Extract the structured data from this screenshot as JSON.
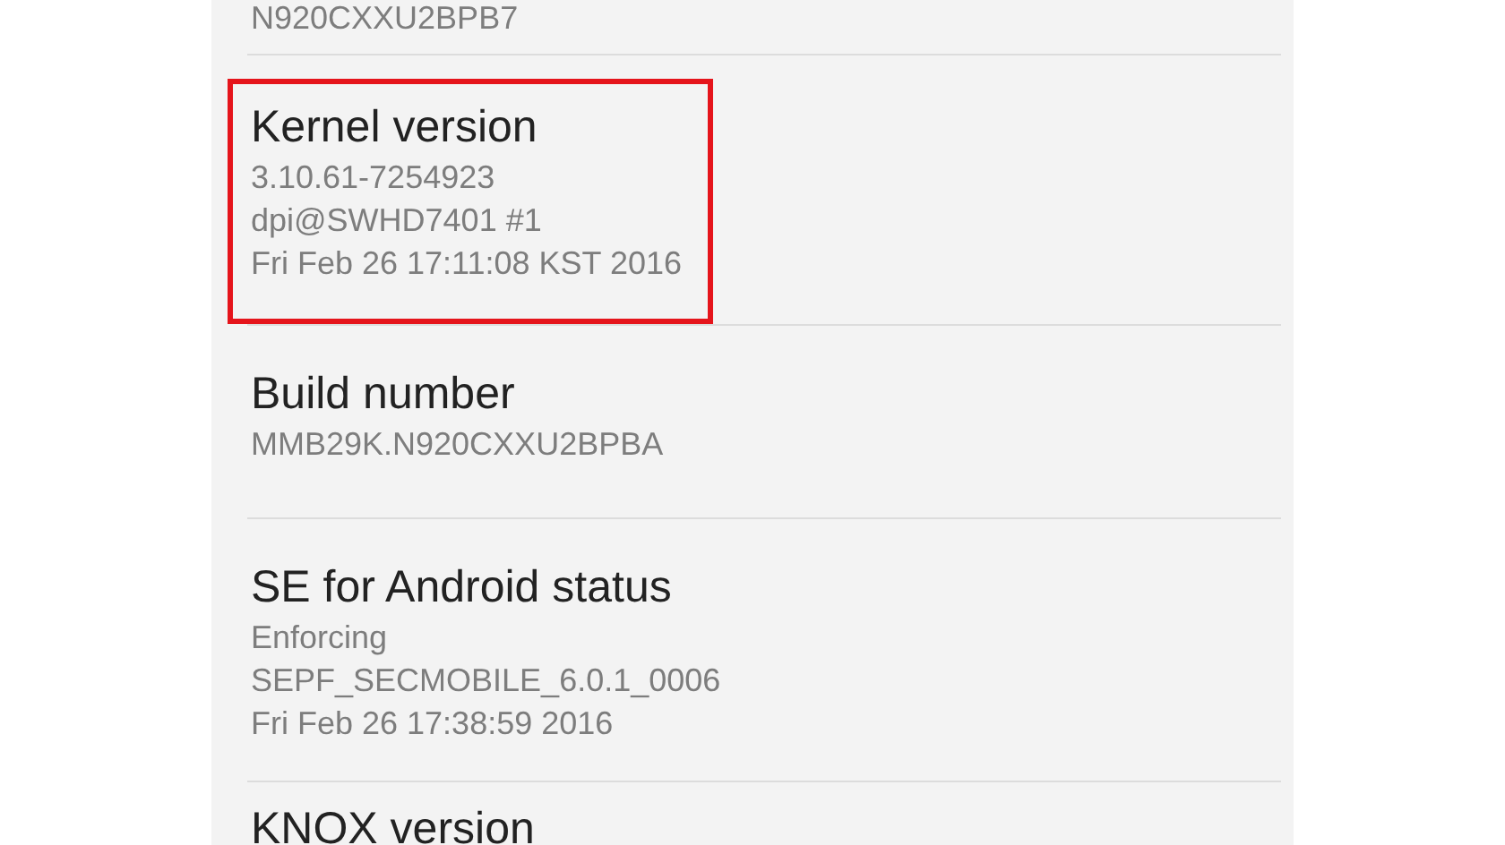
{
  "settings_list": [
    {
      "lines": [
        "N920CXXU2BPB7"
      ],
      "highlighted": false
    },
    {
      "title": "Kernel version",
      "lines": [
        "3.10.61-7254923",
        "dpi@SWHD7401 #1",
        "Fri Feb 26 17:11:08 KST 2016"
      ],
      "highlighted": true
    },
    {
      "title": "Build number",
      "lines": [
        "MMB29K.N920CXXU2BPBA"
      ],
      "highlighted": false
    },
    {
      "title": "SE for Android status",
      "lines": [
        "Enforcing",
        "SEPF_SECMOBILE_6.0.1_0006",
        "Fri Feb 26 17:38:59 2016"
      ],
      "highlighted": false
    },
    {
      "title": "KNOX version",
      "highlighted": false
    }
  ]
}
